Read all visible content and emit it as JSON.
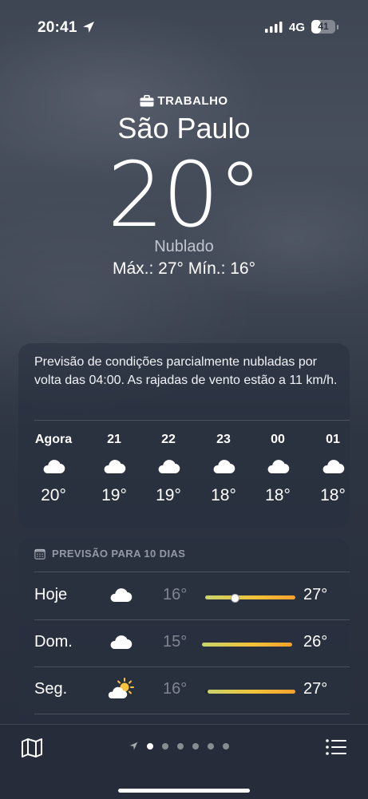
{
  "status": {
    "time": "20:41",
    "network": "4G",
    "battery": "41",
    "battery_level": 0.41
  },
  "header": {
    "location_label": "TRABALHO",
    "city": "São Paulo",
    "temperature": "20°",
    "condition": "Nublado",
    "hilo": "Máx.: 27°  Mín.: 16°"
  },
  "hourly": {
    "summary": "Previsão de condições parcialmente nubladas por volta das 04:00. As rajadas de vento estão a 11 km/h.",
    "items": [
      {
        "label": "Agora",
        "icon": "cloud-icon",
        "temp": "20°"
      },
      {
        "label": "21",
        "icon": "cloud-icon",
        "temp": "19°"
      },
      {
        "label": "22",
        "icon": "cloud-icon",
        "temp": "19°"
      },
      {
        "label": "23",
        "icon": "cloud-icon",
        "temp": "18°"
      },
      {
        "label": "00",
        "icon": "cloud-icon",
        "temp": "18°"
      },
      {
        "label": "01",
        "icon": "cloud-icon",
        "temp": "18°"
      }
    ]
  },
  "daily": {
    "title": "PREVISÃO PARA 10 DIAS",
    "items": [
      {
        "day": "Hoje",
        "icon": "cloud-icon",
        "low": "16°",
        "high": "27°",
        "range_start": 0.0,
        "range_end": 1.0,
        "current": 0.33
      },
      {
        "day": "Dom.",
        "icon": "cloud-icon",
        "low": "15°",
        "high": "26°",
        "range_start": 0.0,
        "range_end": 1.0
      },
      {
        "day": "Seg.",
        "icon": "partly-sunny-icon",
        "low": "16°",
        "high": "27°",
        "range_start": 0.03,
        "range_end": 1.0
      }
    ]
  },
  "pager": {
    "pages": 6,
    "active": 0
  },
  "colors": {
    "bar_start": "#c9d46a",
    "bar_end": "#f4a12c",
    "background": "#3e4553"
  }
}
